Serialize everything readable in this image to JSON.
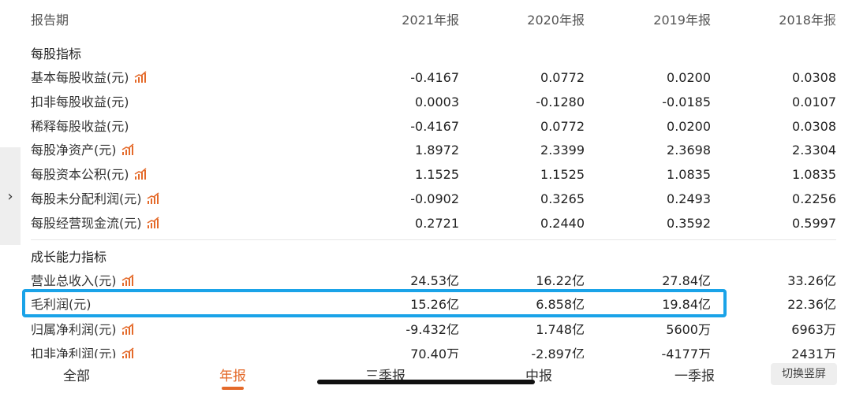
{
  "columns": [
    "报告期",
    "2021年报",
    "2020年报",
    "2019年报",
    "2018年报"
  ],
  "sections": [
    {
      "title": "每股指标",
      "rows": [
        {
          "label": "基本每股收益(元)",
          "chart": true,
          "values": [
            "-0.4167",
            "0.0772",
            "0.0200",
            "0.0308"
          ]
        },
        {
          "label": "扣非每股收益(元)",
          "chart": false,
          "values": [
            "0.0003",
            "-0.1280",
            "-0.0185",
            "0.0107"
          ]
        },
        {
          "label": "稀释每股收益(元)",
          "chart": false,
          "values": [
            "-0.4167",
            "0.0772",
            "0.0200",
            "0.0308"
          ]
        },
        {
          "label": "每股净资产(元)",
          "chart": true,
          "values": [
            "1.8972",
            "2.3399",
            "2.3698",
            "2.3304"
          ]
        },
        {
          "label": "每股资本公积(元)",
          "chart": true,
          "values": [
            "1.1525",
            "1.1525",
            "1.0835",
            "1.0835"
          ]
        },
        {
          "label": "每股未分配利润(元)",
          "chart": true,
          "values": [
            "-0.0902",
            "0.3265",
            "0.2493",
            "0.2256"
          ]
        },
        {
          "label": "每股经营现金流(元)",
          "chart": true,
          "values": [
            "0.2721",
            "0.2440",
            "0.3592",
            "0.5997"
          ]
        }
      ]
    },
    {
      "title": "成长能力指标",
      "rows": [
        {
          "label": "营业总收入(元)",
          "chart": true,
          "values": [
            "24.53亿",
            "16.22亿",
            "27.84亿",
            "33.26亿"
          ]
        },
        {
          "label": "毛利润(元)",
          "chart": false,
          "values": [
            "15.26亿",
            "6.858亿",
            "19.84亿",
            "22.36亿"
          ]
        },
        {
          "label": "归属净利润(元)",
          "chart": true,
          "values": [
            "-9.432亿",
            "1.748亿",
            "5600万",
            "6963万"
          ]
        },
        {
          "label": "扣非净利润(元)",
          "chart": true,
          "values": [
            "70.40万",
            "-2.897亿",
            "-4177万",
            "2431万"
          ]
        }
      ]
    }
  ],
  "side_tab": {
    "glyph": "›"
  },
  "tabs": [
    "全部",
    "年报",
    "三季报",
    "中报",
    "一季报"
  ],
  "active_tab": "年报",
  "switch_button": "切换竖屏",
  "colors": {
    "accent": "#e46a2a",
    "highlight": "#1aa3e8"
  }
}
